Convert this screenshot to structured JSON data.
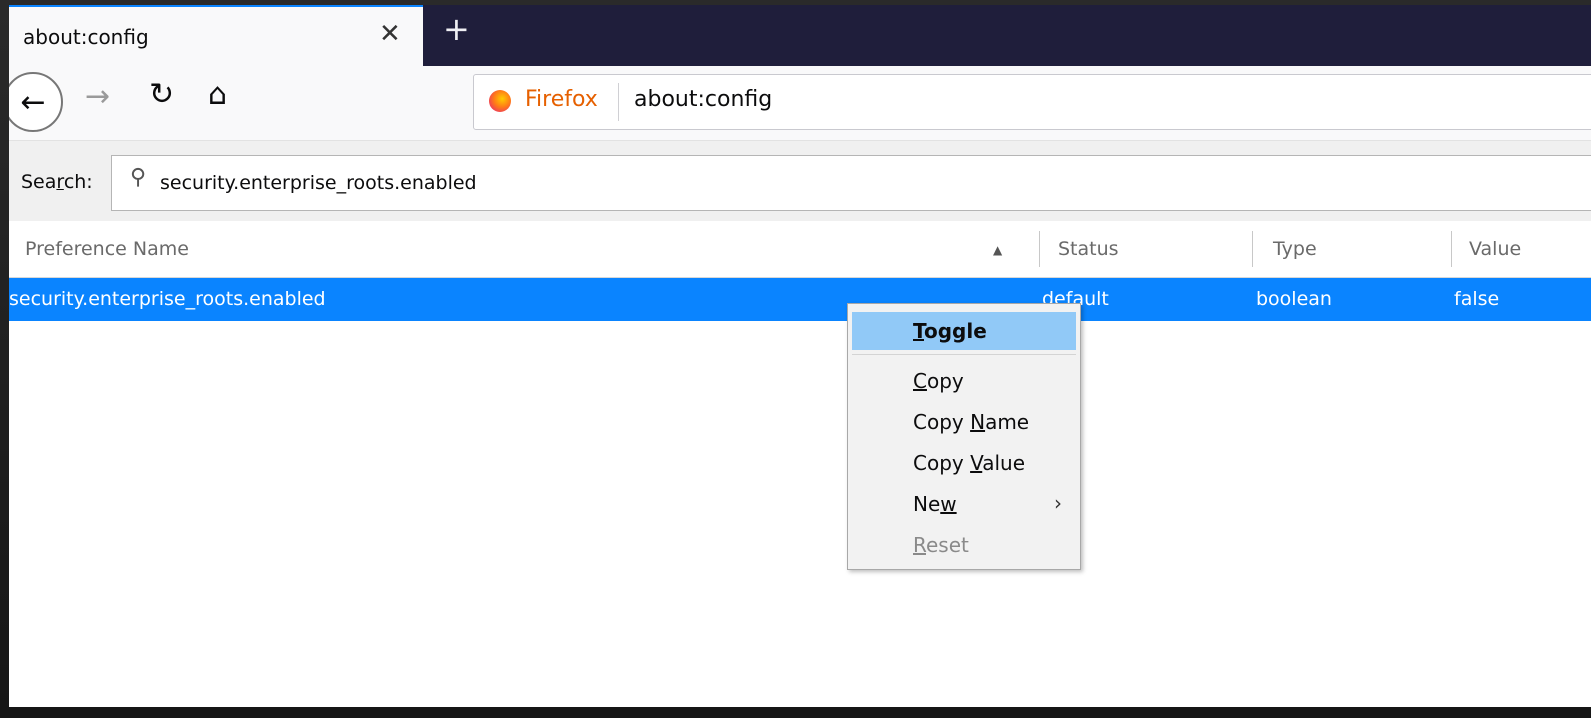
{
  "tab": {
    "title": "about:config",
    "close_glyph": "✕"
  },
  "new_tab_glyph": "+",
  "nav": {
    "back_icon": "←",
    "forward_icon": "→",
    "reload_icon": "↻",
    "home_icon": "⌂"
  },
  "urlbar": {
    "identity_label": "Firefox",
    "url": "about:config"
  },
  "search": {
    "label_pre": "Sea",
    "label_accel": "r",
    "label_post": "ch:",
    "value": "security.enterprise_roots.enabled",
    "icon": "⚲"
  },
  "columns": {
    "name": "Preference Name",
    "sort_glyph": "▲",
    "status": "Status",
    "type": "Type",
    "value": "Value"
  },
  "rows": [
    {
      "name": "security.enterprise_roots.enabled",
      "status": "default",
      "type": "boolean",
      "value": "false"
    }
  ],
  "context_menu": {
    "toggle": {
      "accel": "T",
      "rest": "oggle"
    },
    "copy": {
      "accel": "C",
      "rest": "opy"
    },
    "copy_name": {
      "pre": "Copy ",
      "accel": "N",
      "rest": "ame"
    },
    "copy_value": {
      "pre": "Copy ",
      "accel": "V",
      "rest": "alue"
    },
    "new": {
      "pre": "Ne",
      "accel": "w",
      "rest": "",
      "arrow": "›"
    },
    "reset": {
      "accel": "R",
      "rest": "eset"
    }
  },
  "colors": {
    "accent": "#0a84ff",
    "tabbar": "#1f1e3b",
    "menu_highlight": "#91c9f7"
  }
}
